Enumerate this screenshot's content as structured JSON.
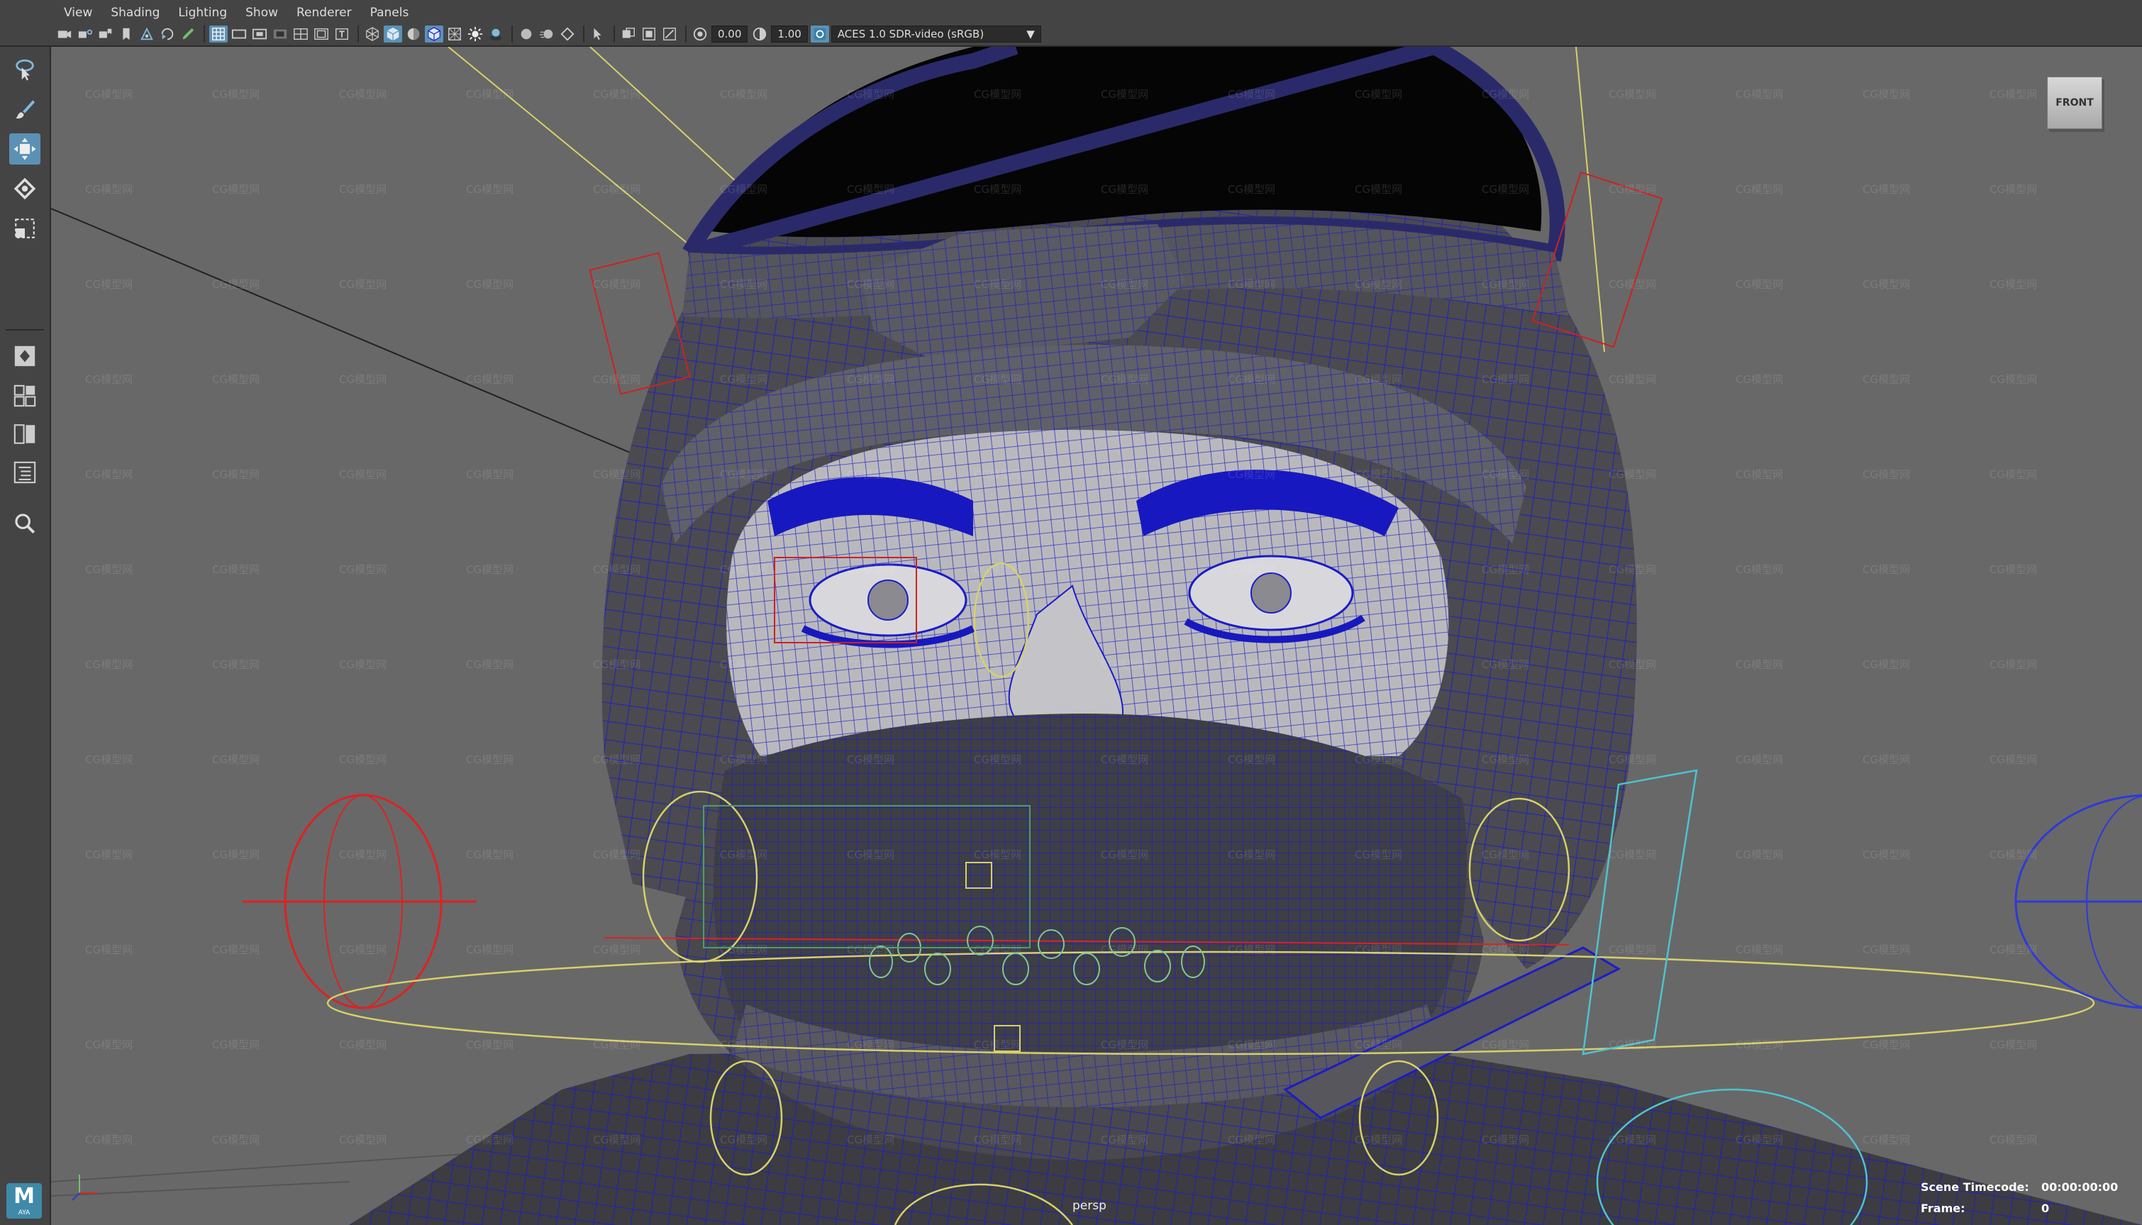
{
  "menus": [
    "View",
    "Shading",
    "Lighting",
    "Show",
    "Renderer",
    "Panels"
  ],
  "toolbar": {
    "exposure_value": "0.00",
    "gamma_value": "1.00",
    "color_management": "ACES 1.0 SDR-video (sRGB)"
  },
  "toolbox": {
    "tools": [
      "select-tool",
      "lasso-tool",
      "paint-select-tool",
      "move-tool",
      "rotate-tool",
      "scale-tool"
    ],
    "active_tool": "move-tool"
  },
  "viewport": {
    "camera_label": "persp",
    "viewcube_face": "FRONT",
    "watermark_text": "CG模型网",
    "background_color": "#686868",
    "wire_color": "#1c1cc8"
  },
  "hud": {
    "timecode_label": "Scene Timecode:",
    "timecode_value": "00:00:00:00",
    "frame_label": "Frame:",
    "frame_value": "0"
  },
  "logo": {
    "letter": "M",
    "subtext": "AYA"
  }
}
